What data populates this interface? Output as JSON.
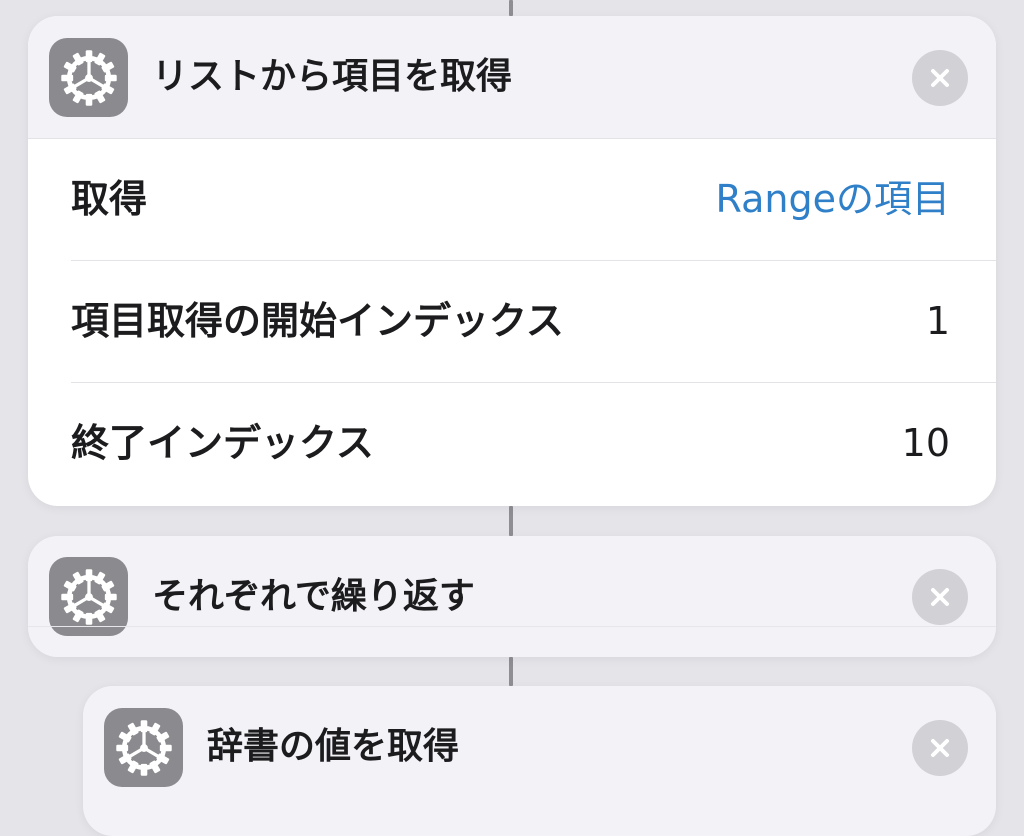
{
  "actions": [
    {
      "title": "リストから項目を取得",
      "icon": "gear-icon",
      "params": [
        {
          "label": "取得",
          "value": "Rangeの項目",
          "style": "link"
        },
        {
          "label": "項目取得の開始インデックス",
          "value": "1"
        },
        {
          "label": "終了インデックス",
          "value": "10"
        }
      ]
    },
    {
      "title": "それぞれで繰り返す",
      "icon": "gear-icon"
    },
    {
      "title": "辞書の値を取得",
      "icon": "gear-icon"
    }
  ],
  "colors": {
    "background": "#e4e4e9",
    "card": "#ffffff",
    "card_header": "#f2f2f7",
    "icon_background": "#8a8a8f",
    "link": "#2f80c8",
    "close_button": "#d1d1d6",
    "connector": "#8e8e93"
  }
}
